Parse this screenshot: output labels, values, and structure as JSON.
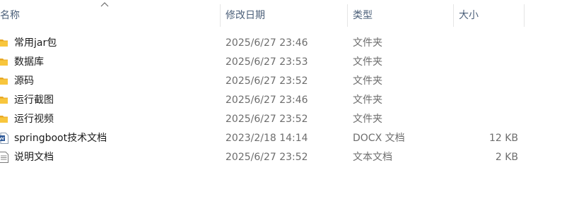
{
  "header": {
    "name": "名称",
    "date": "修改日期",
    "type": "类型",
    "size": "大小"
  },
  "files": [
    {
      "name": "常用jar包",
      "date": "2025/6/27 23:46",
      "type": "文件夹",
      "size": "",
      "icon": "folder-icon"
    },
    {
      "name": "数据库",
      "date": "2025/6/27 23:53",
      "type": "文件夹",
      "size": "",
      "icon": "folder-icon"
    },
    {
      "name": "源码",
      "date": "2025/6/27 23:52",
      "type": "文件夹",
      "size": "",
      "icon": "folder-icon"
    },
    {
      "name": "运行截图",
      "date": "2025/6/27 23:46",
      "type": "文件夹",
      "size": "",
      "icon": "folder-icon"
    },
    {
      "name": "运行视频",
      "date": "2025/6/27 23:52",
      "type": "文件夹",
      "size": "",
      "icon": "folder-icon"
    },
    {
      "name": "springboot技术文档",
      "date": "2023/2/18 14:14",
      "type": "DOCX 文档",
      "size": "12 KB",
      "icon": "word-doc-icon"
    },
    {
      "name": "说明文档",
      "date": "2025/6/27 23:52",
      "type": "文本文档",
      "size": "2 KB",
      "icon": "text-file-icon"
    }
  ],
  "colors": {
    "folder": "#f8c63d",
    "header_text": "#4c607a",
    "secondary_text": "#6d6d6d",
    "word_blue": "#2b5797"
  }
}
